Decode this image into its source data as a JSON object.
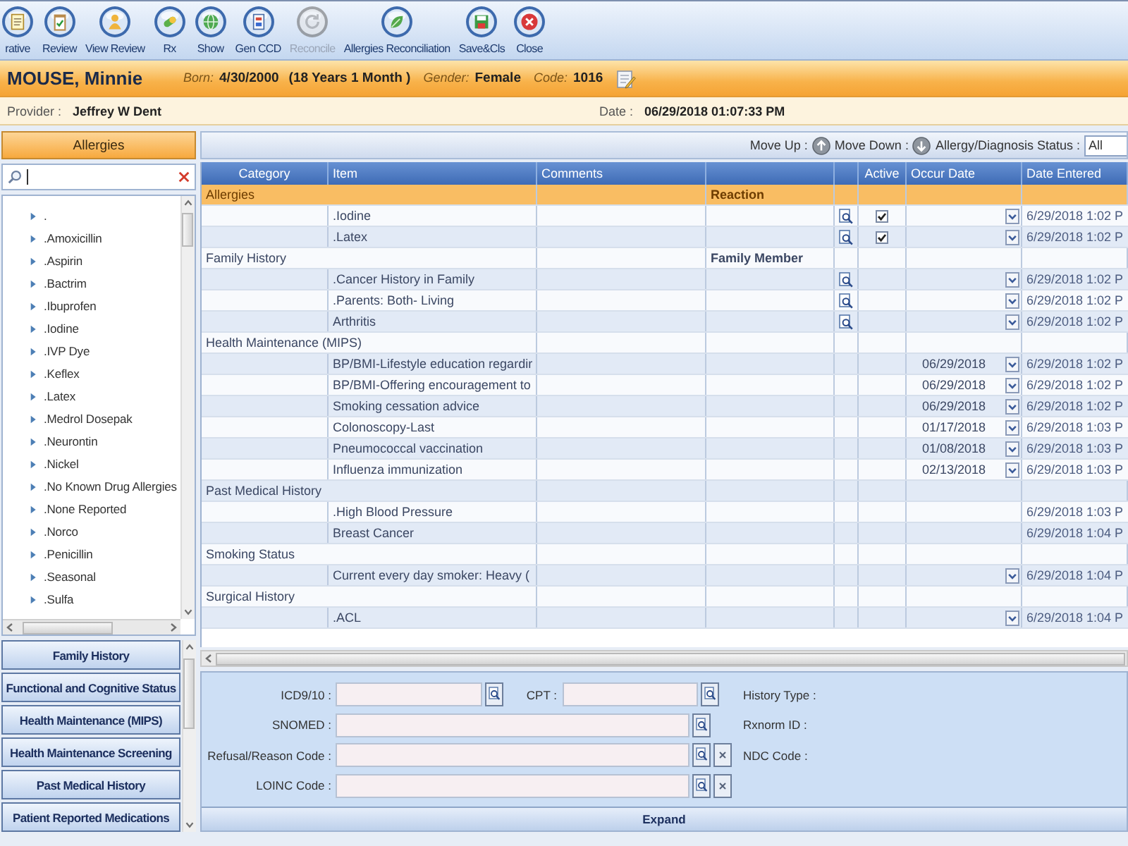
{
  "toolbar": {
    "buttons": [
      {
        "label": "rative",
        "disabled": false
      },
      {
        "label": "Review",
        "disabled": false
      },
      {
        "label": "View Review",
        "disabled": false
      },
      {
        "label": "Rx",
        "disabled": false
      },
      {
        "label": "Show",
        "disabled": false
      },
      {
        "label": "Gen CCD",
        "disabled": false
      },
      {
        "label": "Reconcile",
        "disabled": true
      },
      {
        "label": "Allergies Reconciliation",
        "disabled": false
      },
      {
        "label": "Save&Cls",
        "disabled": false
      },
      {
        "label": "Close",
        "disabled": false
      }
    ]
  },
  "patient_bar": {
    "name": "MOUSE, Minnie",
    "fields": [
      {
        "label": "Born:",
        "value": "4/30/2000",
        "extra": "(18 Years 1 Month )"
      },
      {
        "label": "Gender:",
        "value": "Female"
      },
      {
        "label": "Code:",
        "value": "1016"
      }
    ]
  },
  "info_bar": {
    "provider": {
      "label": "Provider :",
      "value": "Jeffrey W Dent"
    },
    "date": {
      "label": "Date :",
      "value": "06/29/2018 01:07:33 PM"
    }
  },
  "left_panel": {
    "title": "Allergies",
    "items": [
      ".",
      ".Amoxicillin",
      ".Aspirin",
      ".Bactrim",
      ".Ibuprofen",
      ".Iodine",
      ".IVP Dye",
      ".Keflex",
      ".Latex",
      ".Medrol Dosepak",
      ".Neurontin",
      ".Nickel",
      ".No Known Drug Allergies",
      ".None Reported",
      ".Norco",
      ".Penicillin",
      ".Seasonal",
      ".Sulfa"
    ],
    "sections": [
      "Family History",
      "Functional and Cognitive Status",
      "Health Maintenance (MIPS)",
      "Health Maintenance Screening",
      "Past Medical History",
      "Patient Reported Medications"
    ]
  },
  "main_toolbar": {
    "move_up": "Move Up :",
    "move_down": "Move Down :",
    "status": {
      "label": "Allergy/Diagnosis Status :",
      "value": "All"
    }
  },
  "table": {
    "columns": [
      {
        "label": "Category"
      },
      {
        "label": "Item"
      },
      {
        "label": "Comments"
      },
      {},
      {},
      {
        "label": "Active"
      },
      {
        "label": "Occur Date"
      },
      {
        "label": "Date Entered"
      }
    ],
    "rows": [
      {
        "kind": "group",
        "category": "Allergies",
        "column_4": "Reaction",
        "selected": true
      },
      {
        "kind": "item",
        "item": ".Iodine",
        "lookup": true,
        "active": true,
        "dropdown": true,
        "date_entered": "6/29/2018 1:02 P",
        "selected": false
      },
      {
        "kind": "item",
        "item": ".Latex",
        "lookup": true,
        "active": true,
        "dropdown": true,
        "date_entered": "6/29/2018 1:02 P",
        "selected": false
      },
      {
        "kind": "group",
        "category": "Family History",
        "column_4": "Family Member",
        "selected": false
      },
      {
        "kind": "item",
        "item": ".Cancer History in Family",
        "lookup": true,
        "dropdown": true,
        "date_entered": "6/29/2018 1:02 P",
        "selected": false
      },
      {
        "kind": "item",
        "item": ".Parents: Both- Living",
        "lookup": true,
        "dropdown": true,
        "date_entered": "6/29/2018 1:02 P",
        "selected": false
      },
      {
        "kind": "item",
        "item": "Arthritis",
        "lookup": true,
        "dropdown": true,
        "date_entered": "6/29/2018 1:02 P",
        "selected": false
      },
      {
        "kind": "group",
        "category": "Health Maintenance (MIPS)",
        "selected": false
      },
      {
        "kind": "item",
        "item": "BP/BMI-Lifestyle education regardir",
        "lookup": false,
        "occur_date": "06/29/2018",
        "dropdown": true,
        "date_entered": "6/29/2018 1:02 P",
        "selected": false
      },
      {
        "kind": "item",
        "item": "BP/BMI-Offering encouragement to",
        "lookup": false,
        "occur_date": "06/29/2018",
        "dropdown": true,
        "date_entered": "6/29/2018 1:02 P",
        "selected": false
      },
      {
        "kind": "item",
        "item": "Smoking cessation advice",
        "lookup": false,
        "occur_date": "06/29/2018",
        "dropdown": true,
        "date_entered": "6/29/2018 1:02 P",
        "selected": false
      },
      {
        "kind": "item",
        "item": "Colonoscopy-Last",
        "lookup": false,
        "occur_date": "01/17/2018",
        "dropdown": true,
        "date_entered": "6/29/2018 1:03 P",
        "selected": false
      },
      {
        "kind": "item",
        "item": "Pneumococcal vaccination",
        "lookup": false,
        "occur_date": "01/08/2018",
        "dropdown": true,
        "date_entered": "6/29/2018 1:03 P",
        "selected": false
      },
      {
        "kind": "item",
        "item": "Influenza immunization",
        "lookup": false,
        "occur_date": "02/13/2018",
        "dropdown": true,
        "date_entered": "6/29/2018 1:03 P",
        "selected": false
      },
      {
        "kind": "group",
        "category": "Past Medical History",
        "selected": false
      },
      {
        "kind": "item",
        "item": ".High Blood Pressure",
        "lookup": false,
        "dropdown": false,
        "date_entered": "6/29/2018 1:03 P",
        "selected": false
      },
      {
        "kind": "item",
        "item": "Breast Cancer",
        "lookup": false,
        "dropdown": false,
        "date_entered": "6/29/2018 1:04 P",
        "selected": false
      },
      {
        "kind": "group",
        "category": "Smoking Status",
        "selected": false
      },
      {
        "kind": "item",
        "item": "Current every day smoker: Heavy (",
        "lookup": false,
        "dropdown": true,
        "date_entered": "6/29/2018 1:04 P",
        "selected": false
      },
      {
        "kind": "group",
        "category": "Surgical History",
        "selected": false
      },
      {
        "kind": "item",
        "item": ".ACL",
        "lookup": false,
        "dropdown": true,
        "date_entered": "6/29/2018 1:04 P",
        "selected": false
      }
    ]
  },
  "detail_form": {
    "rows": [
      {
        "fields": [
          {
            "label": "ICD9/10 :",
            "clear_button": false
          },
          {
            "label": "CPT :",
            "clear_button": false
          }
        ],
        "side_label": "History Type :"
      },
      {
        "fields": [
          {
            "label": "SNOMED :",
            "clear_button": false
          }
        ],
        "side_label": "Rxnorm ID :"
      },
      {
        "fields": [
          {
            "label": "Refusal/Reason Code :",
            "clear_button": true
          }
        ],
        "side_label": "NDC Code :"
      },
      {
        "fields": [
          {
            "label": "LOINC Code :",
            "clear_button": true
          }
        ]
      }
    ],
    "expand": "Expand"
  }
}
